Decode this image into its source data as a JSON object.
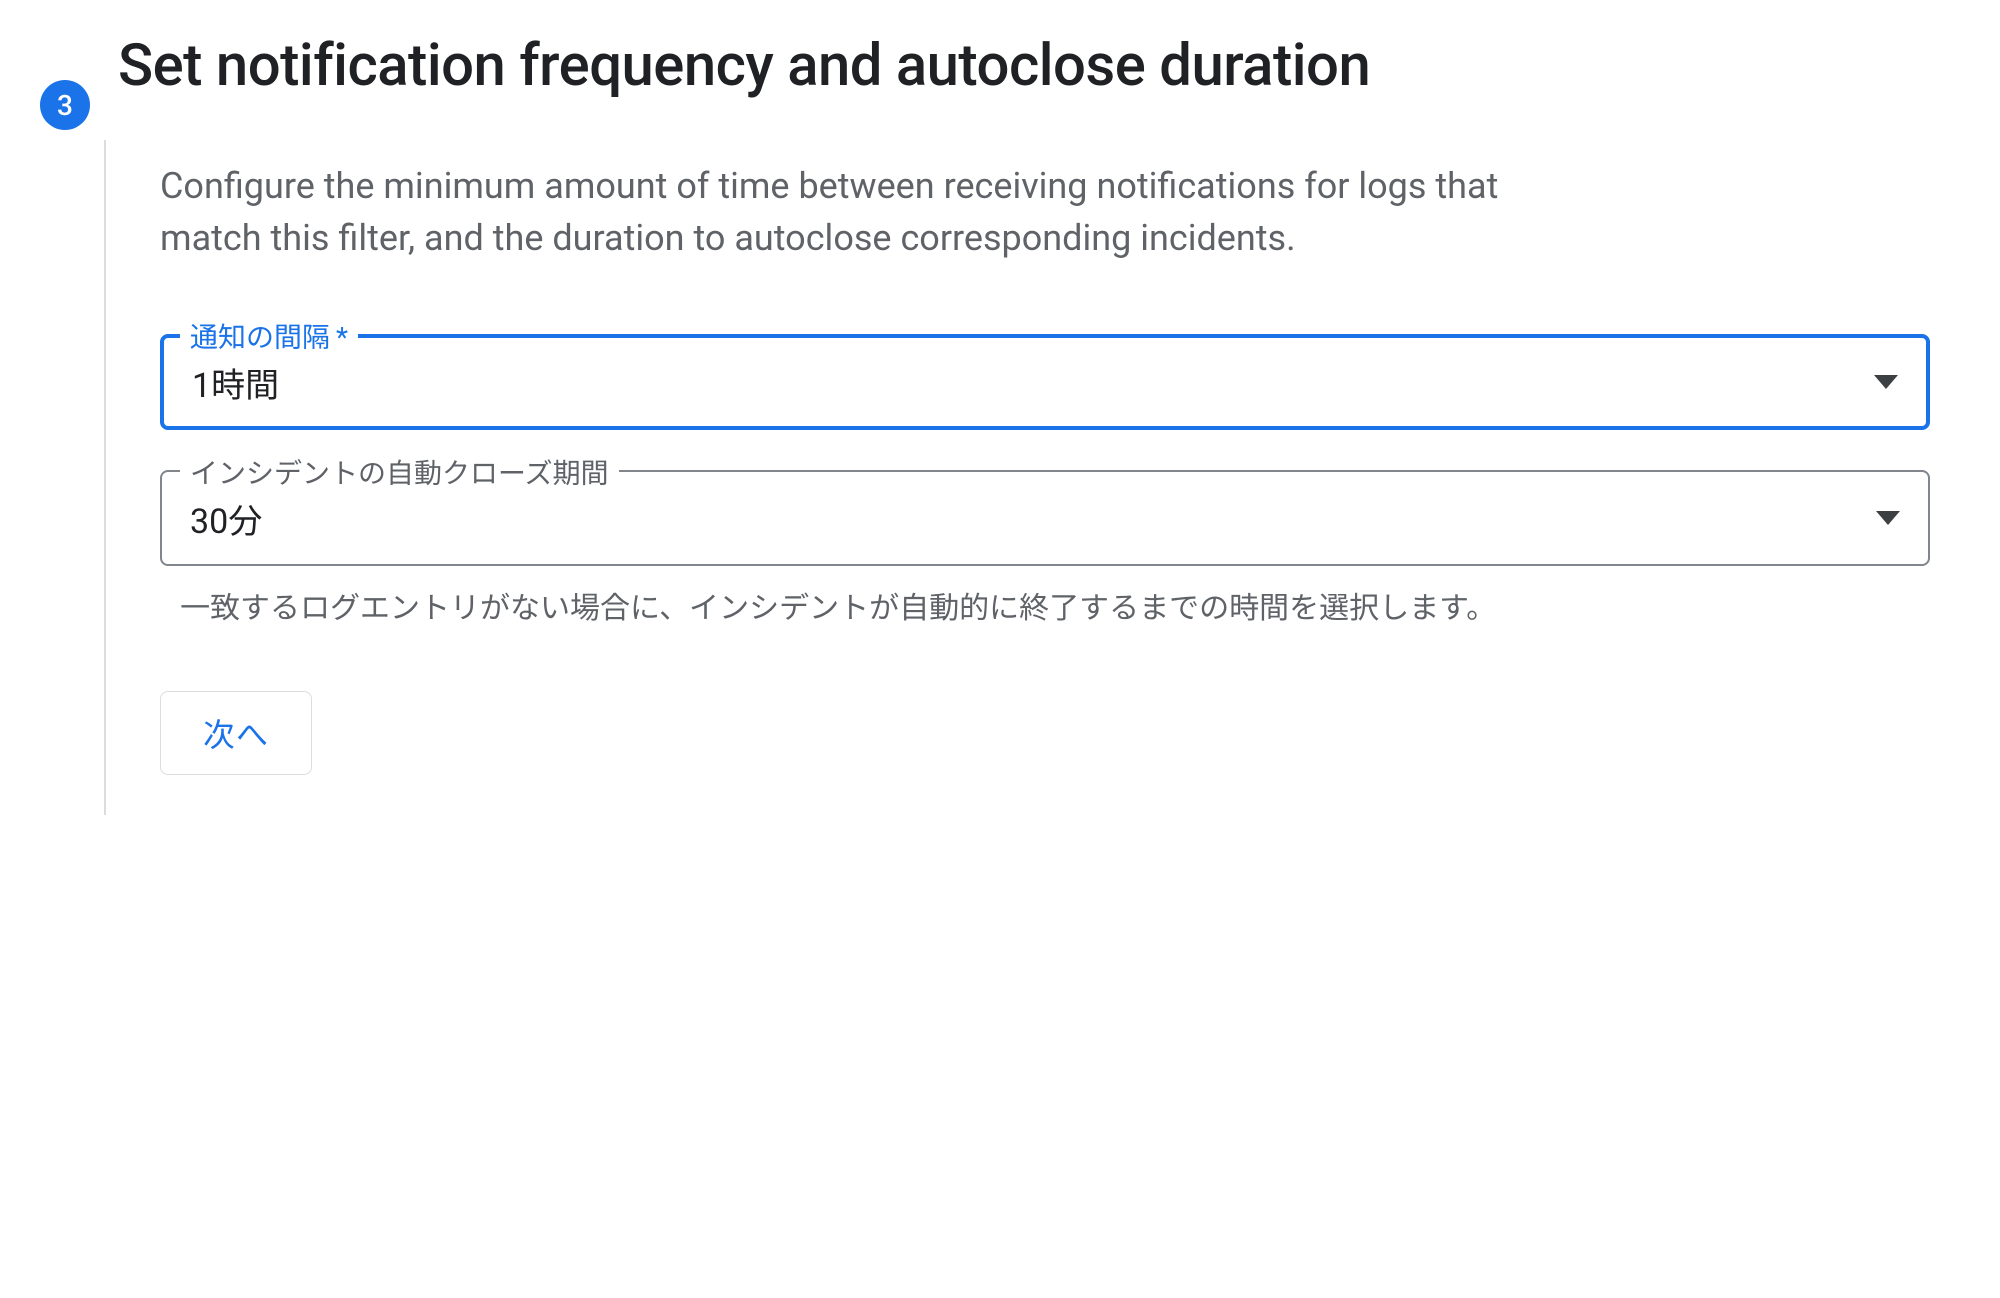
{
  "step": {
    "number": "3",
    "title": "Set notification frequency and autoclose duration",
    "description": "Configure the minimum amount of time between receiving notifications for logs that match this filter, and the duration to autoclose corresponding incidents."
  },
  "fields": {
    "notification_interval": {
      "label": "通知の間隔",
      "required_mark": "*",
      "value": "1時間"
    },
    "autoclose_duration": {
      "label": "インシデントの自動クローズ期間",
      "value": "30分",
      "helper": "一致するログエントリがない場合に、インシデントが自動的に終了するまでの時間を選択します。"
    }
  },
  "buttons": {
    "next": "次へ"
  }
}
